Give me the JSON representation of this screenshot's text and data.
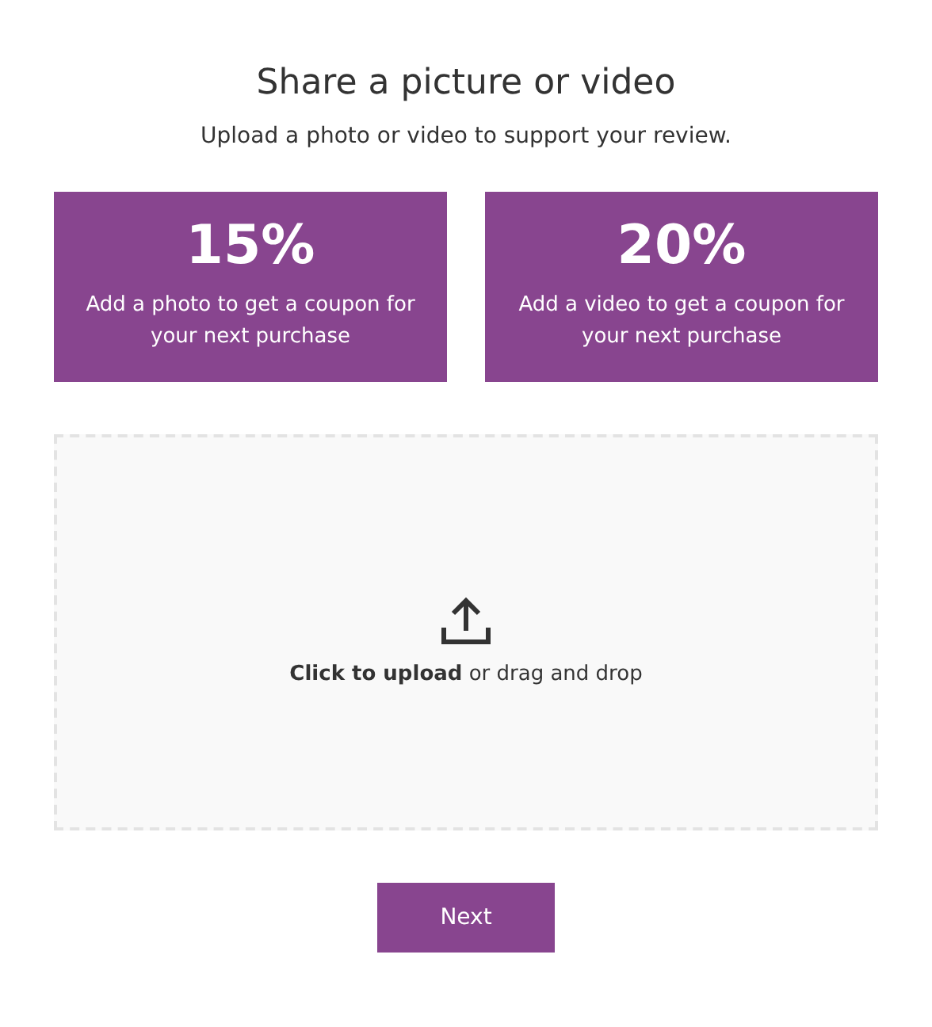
{
  "title": "Share a picture or video",
  "subtitle": "Upload a photo or video to support your review.",
  "offers": [
    {
      "percent": "15%",
      "description": "Add a photo to get a coupon for your next purchase"
    },
    {
      "percent": "20%",
      "description": "Add a video to get a coupon for your next purchase"
    }
  ],
  "dropzone": {
    "text": "**Click to upload** or drag and drop"
  },
  "next_button": "Next"
}
